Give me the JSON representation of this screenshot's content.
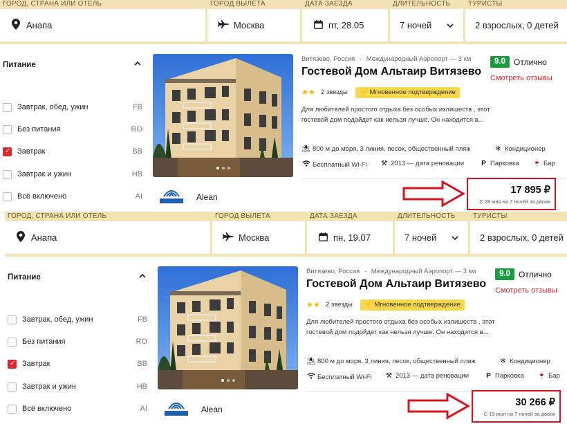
{
  "panels": [
    {
      "search": {
        "city_label": "ГОРОД, СТРАНА ИЛИ ОТЕЛЬ",
        "city_value": "Анапа",
        "from_label": "ГОРОД ВЫЛЕТА",
        "from_value": "Москва",
        "date_label": "ДАТА ЗАЕЗДА",
        "date_value": "пт, 28.05",
        "duration_label": "ДЛИТЕЛЬНОСТЬ",
        "duration_value": "7 ночей",
        "tourists_label": "ТУРИСТЫ",
        "tourists_value": "2 взрослых, 0 детей"
      },
      "filter": {
        "title": "Питание",
        "options": [
          {
            "label": "Завтрак, обед, ужин",
            "code": "FB",
            "checked": false
          },
          {
            "label": "Без питания",
            "code": "RO",
            "checked": false
          },
          {
            "label": "Завтрак",
            "code": "BB",
            "checked": true
          },
          {
            "label": "Завтрак и ужин",
            "code": "HB",
            "checked": false
          },
          {
            "label": "Всё включено",
            "code": "AI",
            "checked": false
          }
        ]
      },
      "hotel": {
        "location": "Витязево, Россия",
        "airport": "Международный Аэропорт — 3 км",
        "name": "Гостевой Дом Альтаир Витязево",
        "stars_label": "2 звезды",
        "badge": "Мгновенное подтверждение",
        "description": "Для любителей простого отдыха без особых излишеств , этот гостевой дом подойдет как нельзя лучше. Он находится в...",
        "score": "9.0",
        "score_label": "Отлично",
        "reviews_link": "Смотреть отзывы",
        "features": {
          "beach": "800 м до моря, 3 линия, песок, общественный пляж",
          "ac": "Кондиционер",
          "wifi": "Бесплатный Wi-Fi",
          "renovation": "2013 — дата реновации",
          "parking": "Парковка",
          "bar": "Бар"
        },
        "operator": "Alean",
        "price": "17 895 ₽",
        "price_note": "С 28 мая на 7 ночей за двоих"
      }
    },
    {
      "search": {
        "city_label": "ГОРОД, СТРАНА ИЛИ ОТЕЛЬ",
        "city_value": "Анапа",
        "from_label": "ГОРОД ВЫЛЕТА",
        "from_value": "Москва",
        "date_label": "ДАТА ЗАЕЗДА",
        "date_value": "пн, 19.07",
        "duration_label": "ДЛИТЕЛЬНОСТЬ",
        "duration_value": "7 ночей",
        "tourists_label": "ТУРИСТЫ",
        "tourists_value": "2 взрослых, 0 детей"
      },
      "filter": {
        "title": "Питание",
        "options": [
          {
            "label": "Завтрак, обед, ужин",
            "code": "FB",
            "checked": false
          },
          {
            "label": "Без питания",
            "code": "RO",
            "checked": false
          },
          {
            "label": "Завтрак",
            "code": "BB",
            "checked": true
          },
          {
            "label": "Завтрак и ужин",
            "code": "HB",
            "checked": false
          },
          {
            "label": "Всё включено",
            "code": "AI",
            "checked": false
          }
        ]
      },
      "hotel": {
        "location": "Витязево, Россия",
        "airport": "Международный Аэропорт — 3 км",
        "name": "Гостевой Дом Альтаир Витязево",
        "stars_label": "2 звезды",
        "badge": "Мгновенное подтверждение",
        "description": "Для любителей простого отдыха без особых излишеств , этот гостевой дом подойдет как нельзя лучше. Он находится в...",
        "score": "9.0",
        "score_label": "Отлично",
        "reviews_link": "Смотреть отзывы",
        "features": {
          "beach": "800 м до моря, 3 линия, песок, общественный пляж",
          "ac": "Кондиционер",
          "wifi": "Бесплатный Wi-Fi",
          "renovation": "2013 — дата реновации",
          "parking": "Парковка",
          "bar": "Бар"
        },
        "operator": "Alean",
        "price": "30 266 ₽",
        "price_note": "С 19 июл на 7 ночей за двоих"
      }
    }
  ],
  "icons": {
    "city": "map-pin-icon",
    "from": "plane-icon",
    "date": "calendar-icon",
    "duration": "chevron-down-icon",
    "filter_toggle": "chevron-up-icon",
    "stars": "star-icon",
    "badge": "lightning-icon",
    "beach": "beach-umbrella-icon",
    "ac": "snowflake-icon",
    "wifi": "wifi-icon",
    "renovation": "hammer-icon",
    "parking": "parking-icon",
    "bar": "wine-glass-icon",
    "arrow": "red-arrow-icon"
  },
  "colors": {
    "search_bg": "#f3e2b4",
    "accent_red": "#e1252c",
    "score_green": "#1a9c3e",
    "badge_yellow": "#f8d84a",
    "star_gold": "#f2b600",
    "price_box_border": "#d4141c"
  }
}
